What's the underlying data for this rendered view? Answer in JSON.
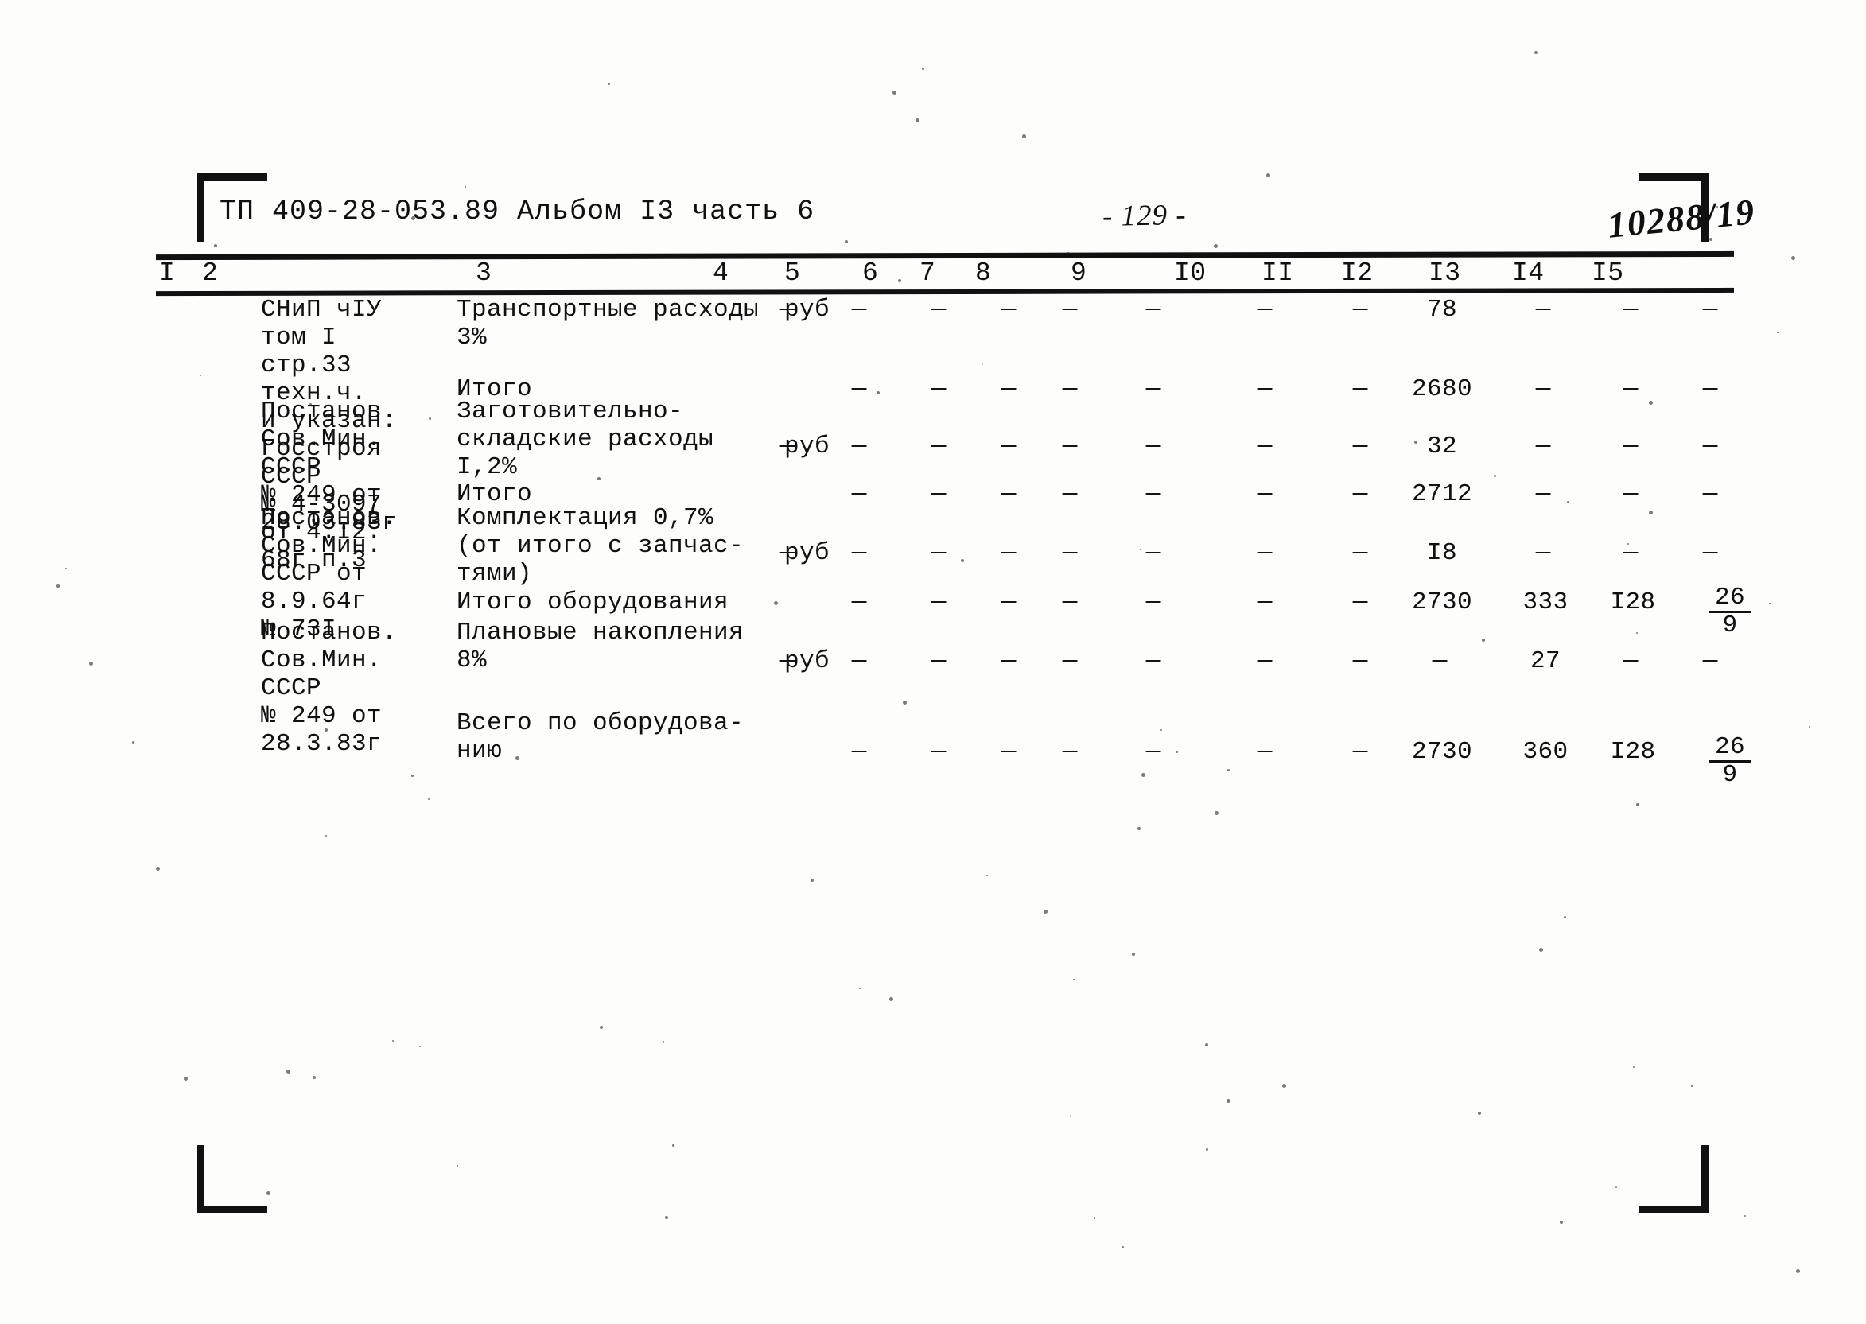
{
  "header": {
    "doc_code": "ТП 409-28-053.89 Альбом I3 часть 6",
    "page_number": "- 129 -",
    "stamp_number": "10288/19"
  },
  "table": {
    "column_numbers": [
      "I",
      "2",
      "3",
      "4",
      "5",
      "6",
      "7",
      "8",
      "9",
      "I0",
      "II",
      "I2",
      "I3",
      "I4",
      "I5"
    ],
    "rows": [
      {
        "justification": "СНиП чIУ\nтом I\nстр.33\nтехн.ч.\nи указан.\nГосстроя\nСССР\n№ 4-3097\nот 4.I2.\n68г п.3",
        "description": "Транспортные расходы\n3%",
        "unit": "руб",
        "c4": "—",
        "c5": "—",
        "c6": "—",
        "c7": "—",
        "c8": "—",
        "c9": "—",
        "c10": "—",
        "c11": "—",
        "c12": "78",
        "c13": "—",
        "c14": "—",
        "c15": "—"
      },
      {
        "justification": "",
        "description": "Итого",
        "unit": "",
        "c4": "",
        "c5": "—",
        "c6": "—",
        "c7": "—",
        "c8": "—",
        "c9": "—",
        "c10": "—",
        "c11": "—",
        "c12": "2680",
        "c13": "—",
        "c14": "—",
        "c15": "—"
      },
      {
        "justification": "Постанов.\nСов.Мин.\nСССР\n№ 249 от\n28.03.83г",
        "description": "Заготовительно-\nскладские расходы\nI,2%",
        "unit": "руб",
        "c4": "—",
        "c5": "—",
        "c6": "—",
        "c7": "—",
        "c8": "—",
        "c9": "—",
        "c10": "—",
        "c11": "—",
        "c12": "32",
        "c13": "—",
        "c14": "—",
        "c15": "—"
      },
      {
        "justification": "",
        "description": "Итого",
        "unit": "",
        "c4": "",
        "c5": "—",
        "c6": "—",
        "c7": "—",
        "c8": "—",
        "c9": "—",
        "c10": "—",
        "c11": "—",
        "c12": "2712",
        "c13": "—",
        "c14": "—",
        "c15": "—"
      },
      {
        "justification": "Постанов.\nСов.Мин.\nСССР от\n8.9.64г\n№ 73I",
        "description": "Комплектация 0,7%\n(от итого с запчас-\nтями)",
        "unit": "руб",
        "c4": "—",
        "c5": "—",
        "c6": "—",
        "c7": "—",
        "c8": "—",
        "c9": "—",
        "c10": "—",
        "c11": "—",
        "c12": "I8",
        "c13": "—",
        "c14": "—",
        "c15": "—"
      },
      {
        "justification": "",
        "description": "Итого оборудования",
        "unit": "",
        "c4": "",
        "c5": "—",
        "c6": "—",
        "c7": "—",
        "c8": "—",
        "c9": "—",
        "c10": "—",
        "c11": "—",
        "c12": "2730",
        "c13": "333",
        "c14": "I28",
        "c15_num": "26",
        "c15_den": "9"
      },
      {
        "justification": "Постанов.\nСов.Мин.\nСССР\n№ 249 от\n28.3.83г",
        "description": "Плановые накопления\n8%",
        "unit": "руб",
        "c4": "—",
        "c5": "—",
        "c6": "—",
        "c7": "—",
        "c8": "—",
        "c9": "—",
        "c10": "—",
        "c11": "—",
        "c12": "—",
        "c13": "27",
        "c14": "—",
        "c15": "—"
      },
      {
        "justification": "",
        "description": "Всего по оборудова-\nнию",
        "unit": "",
        "c4": "",
        "c5": "—",
        "c6": "—",
        "c7": "—",
        "c8": "—",
        "c9": "—",
        "c10": "—",
        "c11": "—",
        "c12": "2730",
        "c13": "360",
        "c14": "I28",
        "c15_num": "26",
        "c15_den": "9"
      }
    ]
  }
}
